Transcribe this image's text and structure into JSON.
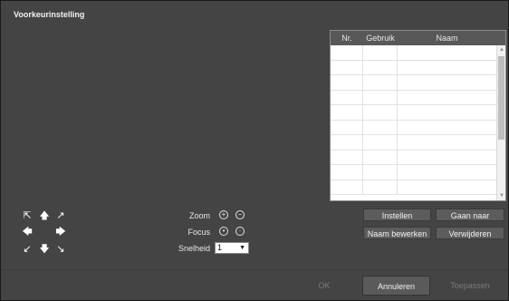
{
  "dialog": {
    "title": "Voorkeurinstelling"
  },
  "preset_table": {
    "headers": [
      "Nr.",
      "Gebruik",
      "Naam"
    ],
    "rows": [
      [
        "",
        "",
        ""
      ],
      [
        "",
        "",
        ""
      ],
      [
        "",
        "",
        ""
      ],
      [
        "",
        "",
        ""
      ],
      [
        "",
        "",
        ""
      ],
      [
        "",
        "",
        ""
      ],
      [
        "",
        "",
        ""
      ],
      [
        "",
        "",
        ""
      ],
      [
        "",
        "",
        ""
      ],
      [
        "",
        "",
        ""
      ]
    ]
  },
  "buttons": {
    "set": "Instellen",
    "goto": "Gaan naar",
    "rename": "Naam bewerken",
    "delete": "Verwijderen"
  },
  "ptz": {
    "zoom_label": "Zoom",
    "focus_label": "Focus",
    "speed_label": "Snelheid",
    "speed_value": "1"
  },
  "footer": {
    "ok": "OK",
    "cancel": "Annuleren",
    "apply": "Toepassen"
  }
}
